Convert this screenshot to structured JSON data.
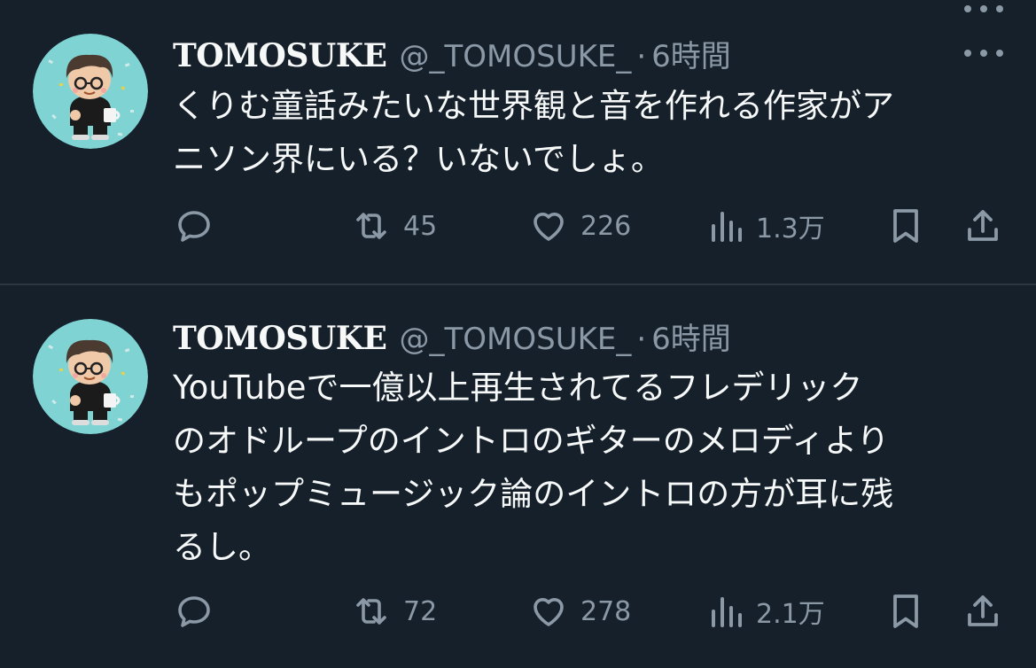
{
  "tweets": [
    {
      "display_name": "TOMOSUKE",
      "handle": "@_TOMOSUKE_",
      "separator": "·",
      "time": "6時間",
      "text": "くりむ童話みたいな世界観と音を作れる作家がア\nニソン界にいる？いないでしょ。",
      "stats": {
        "retweets": "45",
        "likes": "226",
        "views": "1.3万"
      }
    },
    {
      "display_name": "TOMOSUKE",
      "handle": "@_TOMOSUKE_",
      "separator": "·",
      "time": "6時間",
      "text": "YouTubeで一億以上再生されてるフレデリック\nのオドループのイントロのギターのメロディより\nもポップミュージック論のイントロの方が耳に残\nるし。",
      "stats": {
        "retweets": "72",
        "likes": "278",
        "views": "2.1万"
      }
    }
  ],
  "icons": {
    "reply": "reply-icon",
    "retweet": "retweet-icon",
    "like": "heart-icon",
    "views": "views-icon",
    "bookmark": "bookmark-icon",
    "share": "share-icon",
    "more": "more-icon"
  },
  "colors": {
    "background": "#15202b",
    "text_primary": "#f7f9f9",
    "text_secondary": "#8b98a5",
    "avatar_bg": "#7fd3d3",
    "divider": "#2b3640"
  }
}
